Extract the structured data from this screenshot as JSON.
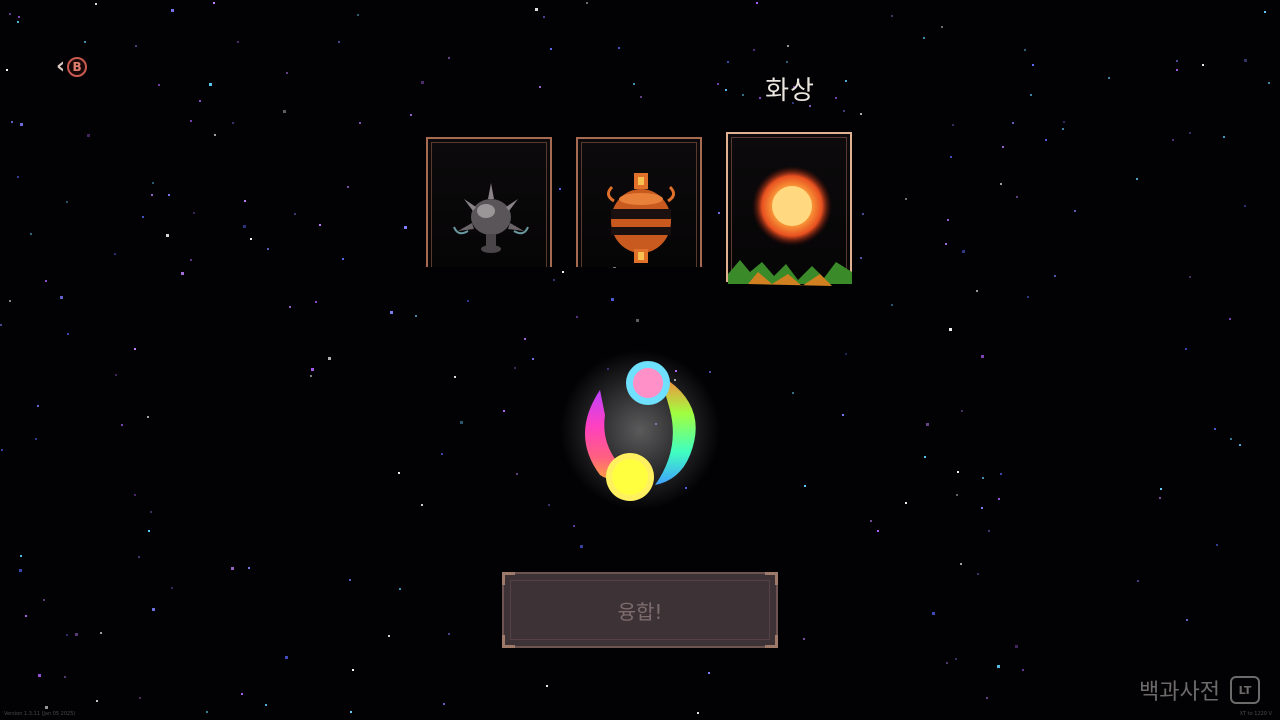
{
  "back": {
    "button_glyph": "B",
    "icon": "chevron-left-icon"
  },
  "selected_card_name": "화상",
  "cards": [
    {
      "icon": "spiked-orb-icon",
      "selected": false
    },
    {
      "icon": "urn-icon",
      "selected": false
    },
    {
      "icon": "fireball-icon",
      "selected": true
    }
  ],
  "fuse_button": {
    "label": "융합!",
    "enabled": false
  },
  "dictionary": {
    "label": "백과사전",
    "button_glyph": "LT"
  },
  "footer": {
    "version_left": "Version 1.3.11 (Jan 05 2025)",
    "version_right": "XT to 1220 V"
  },
  "colors": {
    "card_border": "#a66a50",
    "selected_border": "#e0b090",
    "button_bg": "#3d3236"
  }
}
